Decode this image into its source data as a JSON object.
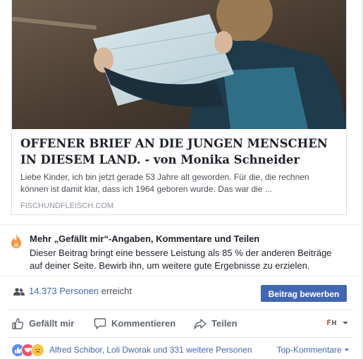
{
  "preview": {
    "title": "OFFENER BRIEF AN DIE JUNGEN MENSCHEN IN DIESEM LAND. - von Monika Schneider",
    "description": "Liebe Kinder, ich bin jetzt gerade 53 Jahre alt geworden. Für die, die rechnen können ist damit klar, dass ich 1964 geboren wurde. Das war die ...",
    "domain": "FISCHUNDFLEISCH.COM"
  },
  "insight": {
    "title": "Mehr „Gefällt mir“-Angaben, Kommentare und Teilen",
    "body": "Dieser Beitrag bringt eine bessere Leistung als 85 % der anderen Beiträge auf deiner Seite. Bewirb ihn, um weitere gute Ergebnisse zu erzielen."
  },
  "reach": {
    "count_link": "14.373 Personen",
    "suffix": "erreicht",
    "promote_label": "Beitrag bewerben"
  },
  "actions": {
    "like": "Gefällt mir",
    "comment": "Kommentieren",
    "share": "Teilen"
  },
  "reactions": {
    "names": "Alfred Schibor, Loli Dworak und 331 weitere Personen",
    "top_comments": "Top-Kommentare"
  },
  "colors": {
    "accent": "#4267b2",
    "like_blue": "#598bff",
    "love_red": "#f25268",
    "flame_orange": "#f7923b"
  }
}
